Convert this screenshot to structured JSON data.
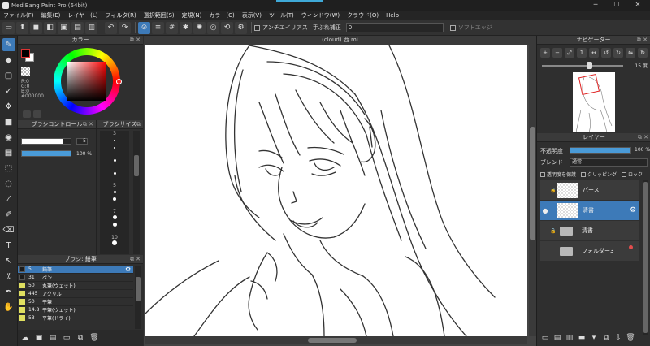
{
  "window": {
    "title": "MediBang Paint Pro (64bit)",
    "minimize": "─",
    "maximize": "☐",
    "close": "✕"
  },
  "menu": [
    "ファイル(F)",
    "編集(E)",
    "レイヤー(L)",
    "フィルタ(R)",
    "選択範囲(S)",
    "定規(N)",
    "カラー(C)",
    "表示(V)",
    "ツール(T)",
    "ウィンドウ(W)",
    "クラウド(O)",
    "Help"
  ],
  "toolbar": {
    "antialias_label": "アンチエイリアス",
    "stabilizer_label": "手ぶれ補正",
    "stabilizer_value": "0",
    "soft_edge_label": "ソフトエッジ"
  },
  "color_panel": {
    "title": "カラー",
    "rgb_text": [
      "R:0",
      "G:0",
      "B:0",
      "#000000"
    ],
    "fg_color": "#000000",
    "bg_color": "#ffffff"
  },
  "brush_control": {
    "title": "ブラシコントロール",
    "size_value": "5",
    "size_fraction": 0.85,
    "opacity_value": "100 %",
    "opacity_fraction": 1.0
  },
  "brush_size": {
    "title": "ブラシサイズ",
    "items": [
      "3",
      "",
      "",
      "",
      "5",
      "",
      "7",
      "",
      "10",
      ""
    ]
  },
  "brush_list": {
    "title": "ブラシ: 鉛筆",
    "rows": [
      {
        "value": "5",
        "name": "鉛筆",
        "dark": true,
        "selected": true
      },
      {
        "value": "31",
        "name": "ペン",
        "dark": true,
        "selected": false
      },
      {
        "value": "50",
        "name": "丸筆(ウェット)",
        "dark": false,
        "selected": false
      },
      {
        "value": "445",
        "name": "アクリル",
        "dark": false,
        "selected": false
      },
      {
        "value": "50",
        "name": "平筆",
        "dark": false,
        "selected": false
      },
      {
        "value": "14.8",
        "name": "平筆(ウェット)",
        "dark": false,
        "selected": false
      },
      {
        "value": "53",
        "name": "平筆(ドライ)",
        "dark": false,
        "selected": false
      }
    ]
  },
  "canvas": {
    "tab_title": "(cloud) 西.mi"
  },
  "navigator": {
    "title": "ナビゲーター",
    "zoom_text": "15 度",
    "zoom_fraction": 0.55
  },
  "layers": {
    "title": "レイヤー",
    "opacity_label": "不透明度",
    "opacity_value": "100 %",
    "opacity_fraction": 1.0,
    "blend_label": "ブレンド",
    "blend_value": "通常",
    "protect_alpha_label": "透明度を保護",
    "clipping_label": "クリッピング",
    "lock_label": "ロック",
    "items": [
      {
        "name": "パース",
        "kind": "layer",
        "visible": false,
        "locked": true,
        "selected": false,
        "sketch": true
      },
      {
        "name": "清書",
        "kind": "layer",
        "visible": true,
        "locked": false,
        "selected": true,
        "gear": true
      },
      {
        "name": "清書",
        "kind": "folder",
        "visible": false,
        "locked": true,
        "selected": false
      },
      {
        "name": "フォルダー3",
        "kind": "folder",
        "visible": false,
        "locked": false,
        "selected": false,
        "red_dot": true
      }
    ]
  },
  "colors": {
    "accent": "#3d7ab8",
    "slider_blue": "#4a9bd8",
    "panel_bg": "#2f2f2f"
  }
}
